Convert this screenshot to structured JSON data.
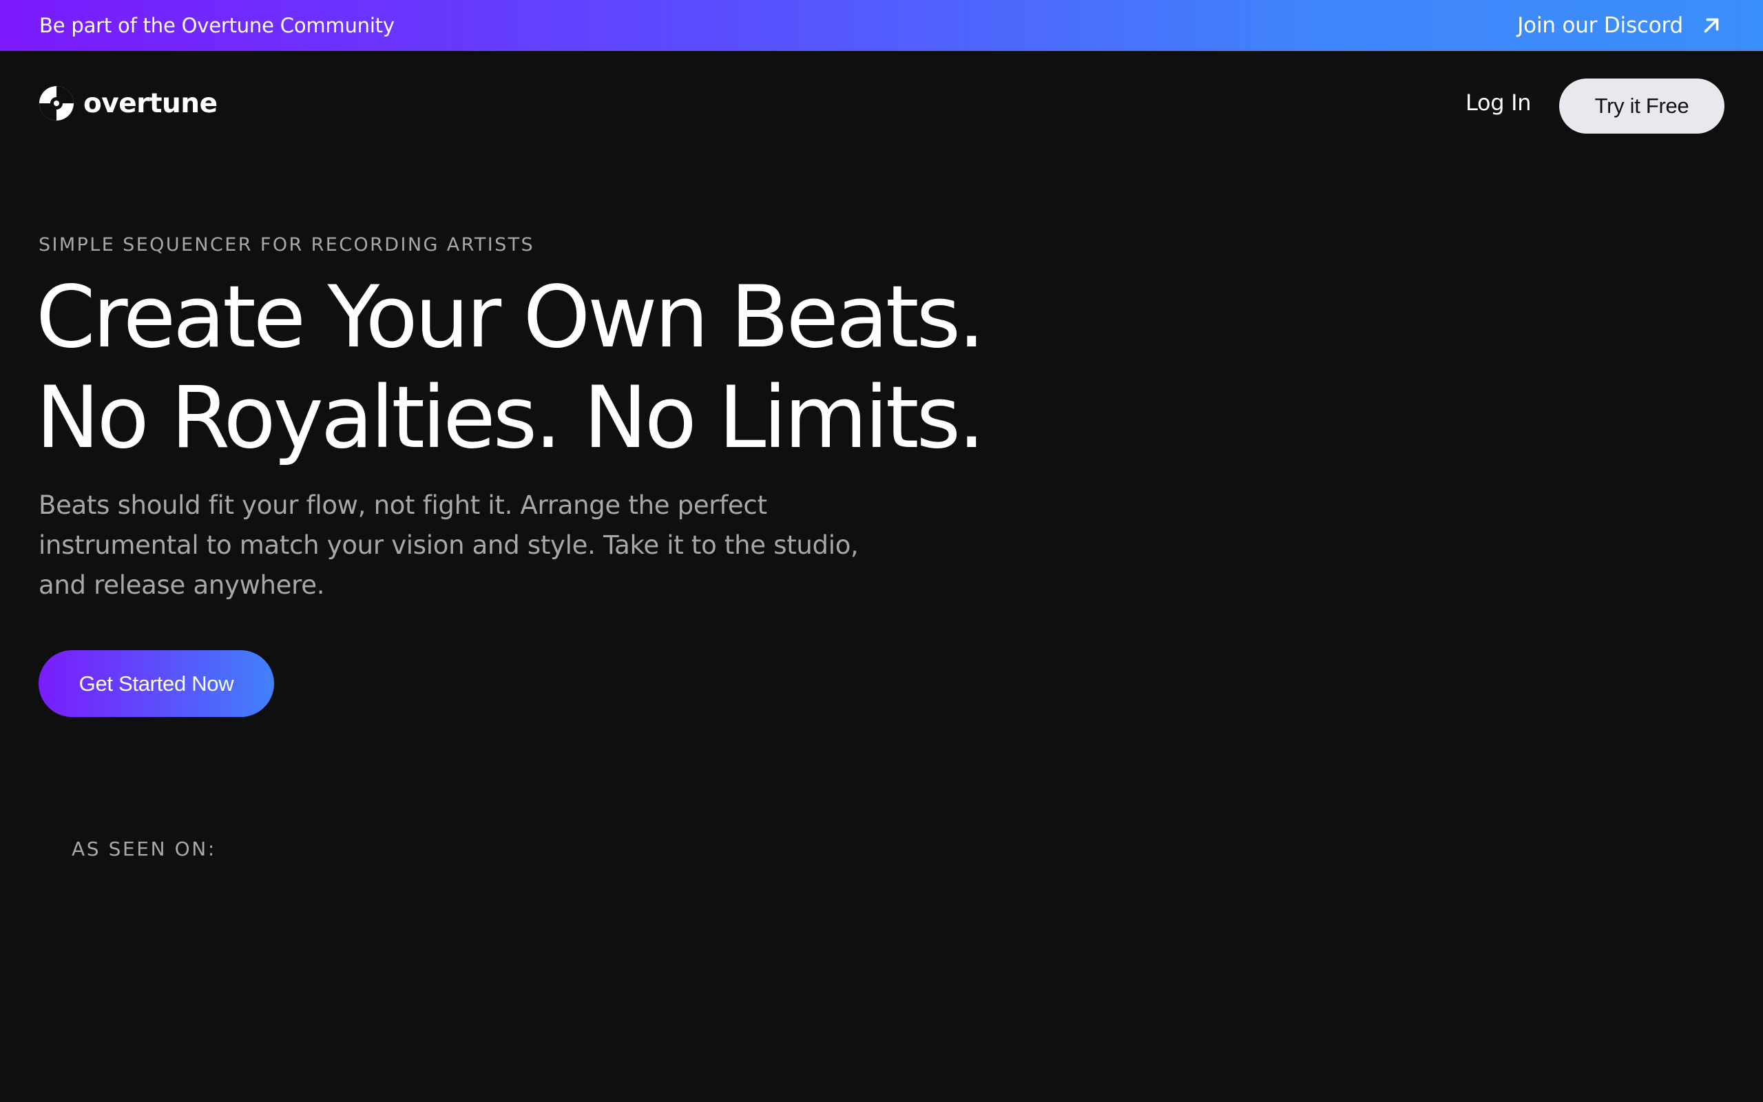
{
  "banner": {
    "text": "Be part of the Overtune Community",
    "link_label": "Join our Discord",
    "link_icon": "arrow-up-right-icon"
  },
  "nav": {
    "logo_text": "overtune",
    "logo_icon": "overtune-logo-icon",
    "login_label": "Log In",
    "try_free_label": "Try it Free"
  },
  "hero": {
    "eyebrow": "SIMPLE SEQUENCER FOR RECORDING ARTISTS",
    "headline_line1": "Create Your Own Beats.",
    "headline_line2": "No Royalties. No Limits.",
    "subtext": "Beats should fit your flow, not fight it. Arrange the perfect instrumental to match your vision and style. Take it to the studio, and release anywhere.",
    "cta_label": "Get Started Now"
  },
  "seen_on": {
    "label": "AS SEEN ON:"
  },
  "colors": {
    "background": "#0f0f0f",
    "gradient_start": "#7b19fc",
    "gradient_end": "#3b8ffa",
    "muted_text": "#a8a8ac",
    "light_button": "#e8e8ee"
  }
}
